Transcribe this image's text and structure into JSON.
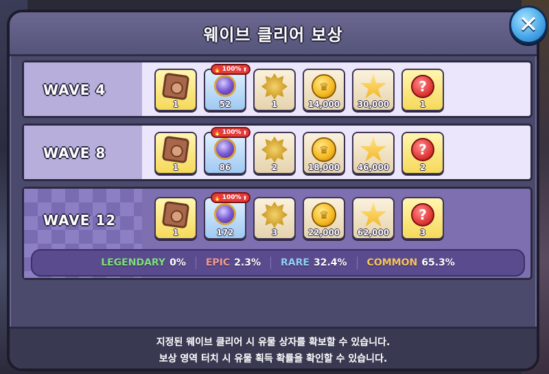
{
  "title": "웨이브 클리어 보상",
  "close_icon": "close-x-icon",
  "waves": [
    {
      "label": "WAVE 4",
      "rewards": [
        {
          "icon": "bronze-medal-icon",
          "qty": "1",
          "bg": "yellow"
        },
        {
          "icon": "purple-gem-icon",
          "qty": "52",
          "bg": "blue",
          "badge": "100%"
        },
        {
          "icon": "golden-lion-icon",
          "qty": "1",
          "bg": "beige"
        },
        {
          "icon": "gold-coin-icon",
          "qty": "14,000",
          "bg": "beige"
        },
        {
          "icon": "star-crown-icon",
          "qty": "30,000",
          "bg": "beige"
        },
        {
          "icon": "question-mark-icon",
          "qty": "1",
          "bg": "yellow"
        }
      ]
    },
    {
      "label": "WAVE 8",
      "rewards": [
        {
          "icon": "bronze-medal-icon",
          "qty": "1",
          "bg": "yellow"
        },
        {
          "icon": "purple-gem-icon",
          "qty": "86",
          "bg": "blue",
          "badge": "100%"
        },
        {
          "icon": "golden-lion-icon",
          "qty": "2",
          "bg": "beige"
        },
        {
          "icon": "gold-coin-icon",
          "qty": "18,000",
          "bg": "beige"
        },
        {
          "icon": "star-crown-icon",
          "qty": "46,000",
          "bg": "beige"
        },
        {
          "icon": "question-mark-icon",
          "qty": "2",
          "bg": "yellow"
        }
      ]
    },
    {
      "label": "WAVE 12",
      "rewards": [
        {
          "icon": "bronze-medal-icon",
          "qty": "1",
          "bg": "yellow"
        },
        {
          "icon": "purple-gem-icon",
          "qty": "172",
          "bg": "blue",
          "badge": "100%"
        },
        {
          "icon": "golden-lion-icon",
          "qty": "3",
          "bg": "beige"
        },
        {
          "icon": "gold-coin-icon",
          "qty": "22,000",
          "bg": "beige"
        },
        {
          "icon": "star-crown-icon",
          "qty": "62,000",
          "bg": "beige"
        },
        {
          "icon": "question-mark-icon",
          "qty": "3",
          "bg": "yellow"
        }
      ]
    }
  ],
  "probabilities": [
    {
      "name": "LEGENDARY",
      "value": "0%",
      "color": "#7fe07a"
    },
    {
      "name": "EPIC",
      "value": "2.3%",
      "color": "#f39a8f"
    },
    {
      "name": "RARE",
      "value": "32.4%",
      "color": "#8fd0f5"
    },
    {
      "name": "COMMON",
      "value": "65.3%",
      "color": "#f7c35a"
    }
  ],
  "footer": {
    "line1": "지정된 웨이브 클리어 시 유물 상자를 확보할 수 있습니다.",
    "line2": "보상 영역 터치 시 유물 획득 확률을 확인할 수 있습니다."
  }
}
